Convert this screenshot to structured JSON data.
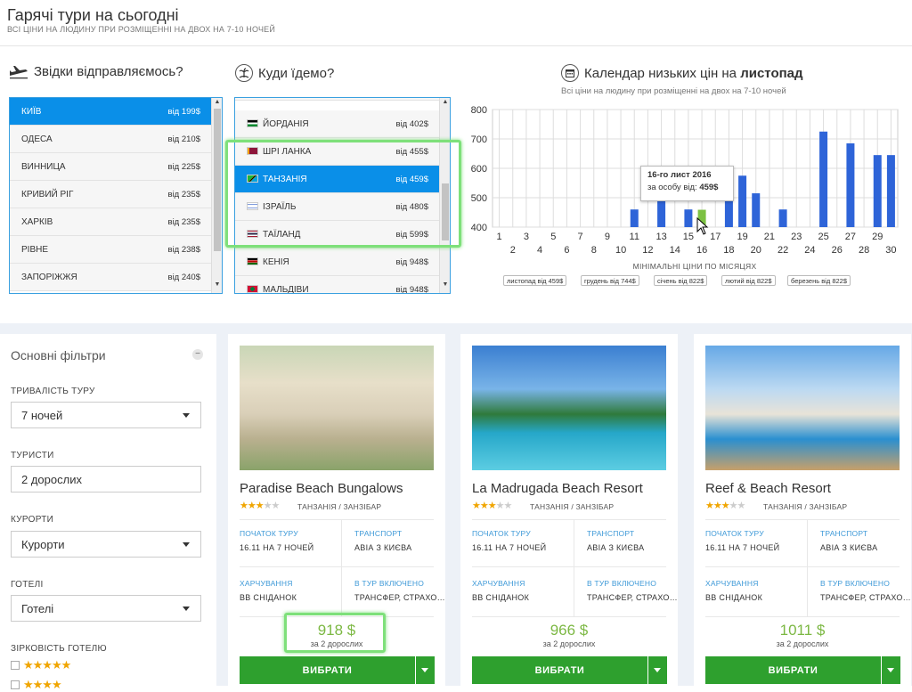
{
  "header": {
    "title": "Гарячі тури на сьогодні",
    "subtitle": "ВСІ ЦІНИ НА ЛЮДИНУ ПРИ РОЗМІЩЕННІ НА ДВОХ НА 7-10 НОЧЕЙ"
  },
  "from": {
    "title": "Звідки відправляємось?",
    "icon": "plane-icon",
    "items": [
      {
        "city": "КИЇВ",
        "price": "від 199$",
        "selected": true
      },
      {
        "city": "ОДЕСА",
        "price": "від 210$"
      },
      {
        "city": "ВИННИЦА",
        "price": "від 225$"
      },
      {
        "city": "КРИВИЙ РІГ",
        "price": "від 235$"
      },
      {
        "city": "ХАРКІВ",
        "price": "від 235$"
      },
      {
        "city": "РІВНЕ",
        "price": "від 238$"
      },
      {
        "city": "ЗАПОРІЖЖЯ",
        "price": "від 240$"
      }
    ]
  },
  "to": {
    "title": "Куди їдемо?",
    "icon": "palm-island-icon",
    "items": [
      {
        "country": "ЙОРДАНІЯ",
        "price": "від 402$",
        "flag": "jordan"
      },
      {
        "country": "ШРІ ЛАНКА",
        "price": "від 455$",
        "flag": "srilanka"
      },
      {
        "country": "ТАНЗАНІЯ",
        "price": "від 459$",
        "flag": "tanzania",
        "selected": true
      },
      {
        "country": "ІЗРАЇЛЬ",
        "price": "від 480$",
        "flag": "israel"
      },
      {
        "country": "ТАЇЛАНД",
        "price": "від 599$",
        "flag": "thailand"
      },
      {
        "country": "КЕНІЯ",
        "price": "від 948$",
        "flag": "kenya"
      },
      {
        "country": "МАЛЬДІВИ",
        "price": "від 948$",
        "flag": "maldives"
      }
    ]
  },
  "calendar": {
    "title_prefix": "Календар низьких цін на ",
    "title_month": "листопад",
    "subtitle": "Всі ціни на людину при розміщенні на двох на 7-10 ночей",
    "icon": "calendar-icon",
    "caption": "МІНІМАЛЬНІ ЦІНИ ПО МІСЯЦЯХ",
    "tooltip": {
      "date": "16-го лист 2016",
      "label": "за особу від: ",
      "price": "459$"
    },
    "months": [
      "листопад від 459$",
      "грудень від 744$",
      "січень від 822$",
      "лютий від 822$",
      "березень від 822$"
    ]
  },
  "chart_data": {
    "type": "bar",
    "ylim": [
      400,
      800
    ],
    "yticks": [
      400,
      500,
      600,
      700,
      800
    ],
    "xticks_top": [
      1,
      3,
      5,
      7,
      9,
      11,
      13,
      15,
      17,
      19,
      21,
      23,
      25,
      27,
      29
    ],
    "xticks_bottom": [
      2,
      4,
      6,
      8,
      10,
      12,
      14,
      16,
      18,
      20,
      22,
      24,
      26,
      28,
      30
    ],
    "days": [
      11,
      13,
      15,
      16,
      18,
      19,
      20,
      22,
      25,
      27,
      29,
      30
    ],
    "values": [
      460,
      490,
      460,
      459,
      500,
      575,
      515,
      460,
      725,
      685,
      645,
      645
    ],
    "highlight_day": 16,
    "bar_color": "#2e64d8",
    "highlight_color": "#7cc142"
  },
  "filters": {
    "title": "Основні фільтри",
    "collapse": "−",
    "duration_label": "ТРИВАЛІСТЬ ТУРУ",
    "duration_value": "7 ночей",
    "tourists_label": "ТУРИСТИ",
    "tourists_value": "2 дорослих",
    "resorts_label": "КУРОРТИ",
    "resorts_value": "Курорти",
    "hotels_label": "ГОТЕЛІ",
    "hotels_value": "Готелі",
    "stars_label": "ЗІРКОВІСТЬ ГОТЕЛЮ",
    "stars5": "★★★★★",
    "stars4": "★★★★"
  },
  "cards": [
    {
      "name": "Paradise Beach Bungalows",
      "location": "ТАНЗАНІЯ / ЗАНЗІБАР",
      "start_label": "ПОЧАТОК ТУРУ",
      "start": "16.11 НА 7 НОЧЕЙ",
      "transport_label": "ТРАНСПОРТ",
      "transport": "АВІА З КИЄВА",
      "meal_label": "ХАРЧУВАННЯ",
      "meal": "BB СНІДАНОК",
      "incl_label": "В ТУР ВКЛЮЧЕНО",
      "incl": "ТРАНСФЕР, СТРАХО…",
      "price": "918 $",
      "price_sub": "за 2 дорослих",
      "button": "ВИБРАТИ",
      "stars": 3
    },
    {
      "name": "La Madrugada Beach Resort",
      "location": "ТАНЗАНІЯ / ЗАНЗІБАР",
      "start_label": "ПОЧАТОК ТУРУ",
      "start": "16.11 НА 7 НОЧЕЙ",
      "transport_label": "ТРАНСПОРТ",
      "transport": "АВІА З КИЄВА",
      "meal_label": "ХАРЧУВАННЯ",
      "meal": "BB СНІДАНОК",
      "incl_label": "В ТУР ВКЛЮЧЕНО",
      "incl": "ТРАНСФЕР, СТРАХО…",
      "price": "966 $",
      "price_sub": "за 2 дорослих",
      "button": "ВИБРАТИ",
      "stars": 3
    },
    {
      "name": "Reef & Beach Resort",
      "location": "ТАНЗАНІЯ / ЗАНЗІБАР",
      "start_label": "ПОЧАТОК ТУРУ",
      "start": "16.11 НА 7 НОЧЕЙ",
      "transport_label": "ТРАНСПОРТ",
      "transport": "АВІА З КИЄВА",
      "meal_label": "ХАРЧУВАННЯ",
      "meal": "BB СНІДАНОК",
      "incl_label": "В ТУР ВКЛЮЧЕНО",
      "incl": "ТРАНСФЕР, СТРАХО…",
      "price": "1011 $",
      "price_sub": "за 2 дорослих",
      "button": "ВИБРАТИ",
      "stars": 3
    }
  ]
}
